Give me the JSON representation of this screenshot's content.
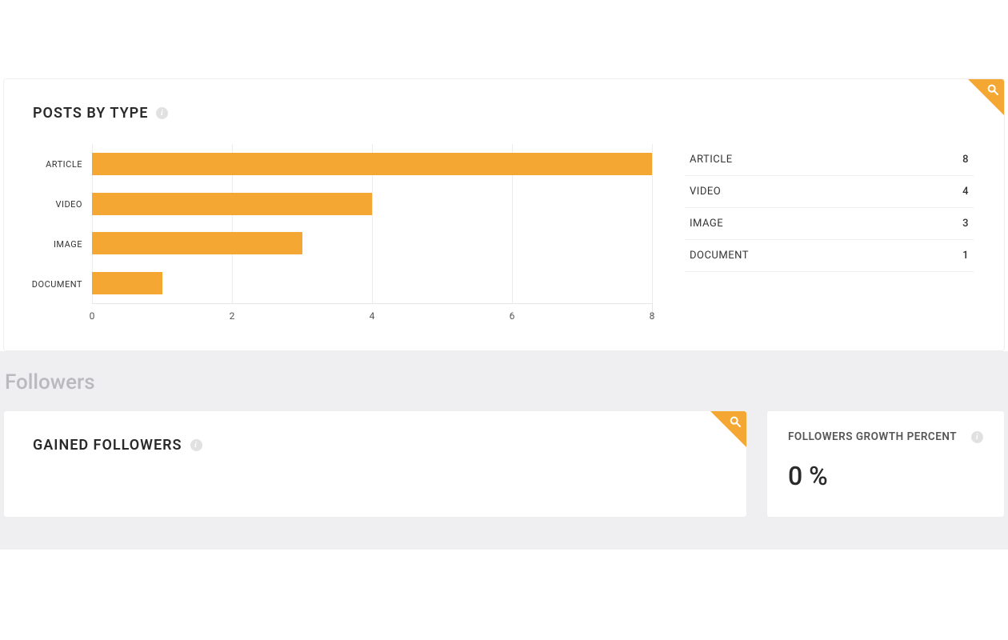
{
  "posts_card": {
    "title": "POSTS BY TYPE"
  },
  "posts_table": [
    {
      "label": "ARTICLE",
      "value": "8"
    },
    {
      "label": "VIDEO",
      "value": "4"
    },
    {
      "label": "IMAGE",
      "value": "3"
    },
    {
      "label": "DOCUMENT",
      "value": "1"
    }
  ],
  "section_heading": "Followers",
  "gained_card": {
    "title": "GAINED FOLLOWERS"
  },
  "growth_card": {
    "title": "FOLLOWERS GROWTH PERCENT",
    "value": "0 %"
  },
  "colors": {
    "accent": "#f4a733"
  },
  "chart_data": {
    "type": "bar",
    "orientation": "horizontal",
    "categories": [
      "ARTICLE",
      "VIDEO",
      "IMAGE",
      "DOCUMENT"
    ],
    "values": [
      8,
      4,
      3,
      1
    ],
    "xticks": [
      0,
      2,
      4,
      6,
      8
    ],
    "xlim": [
      0,
      8
    ],
    "title": "POSTS BY TYPE",
    "xlabel": "",
    "ylabel": ""
  }
}
